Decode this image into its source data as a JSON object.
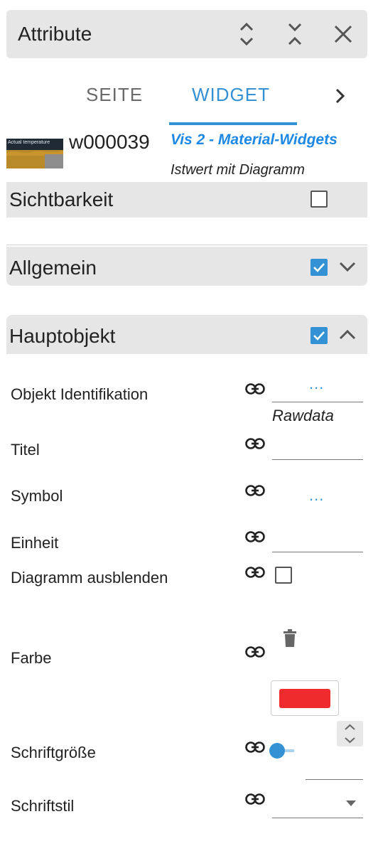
{
  "header": {
    "title": "Attribute"
  },
  "tabs": {
    "seite": "SEITE",
    "widget": "WIDGET"
  },
  "widget": {
    "id": "w000039",
    "set_name": "Vis 2 - Material-Widgets",
    "type_name": "Istwert mit Diagramm",
    "thumbnail_text": "Actual temperature"
  },
  "sections": {
    "sichtbarkeit": {
      "title": "Sichtbarkeit",
      "checked": false
    },
    "allgemein": {
      "title": "Allgemein",
      "checked": true,
      "expanded": false
    },
    "hauptobjekt": {
      "title": "Hauptobjekt",
      "checked": true,
      "expanded": true
    }
  },
  "properties": {
    "objekt_identifikation": {
      "label": "Objekt Identifikation",
      "button": "...",
      "value": "Rawdata"
    },
    "titel": {
      "label": "Titel",
      "value": ""
    },
    "symbol": {
      "label": "Symbol",
      "button": "..."
    },
    "einheit": {
      "label": "Einheit",
      "value": ""
    },
    "diagramm_ausblenden": {
      "label": "Diagramm ausblenden",
      "checked": false
    },
    "farbe": {
      "label": "Farbe",
      "color": "#ef2b2d"
    },
    "schriftgroesse": {
      "label": "Schriftgröße",
      "value": ""
    },
    "schriftstil": {
      "label": "Schriftstil",
      "value": ""
    }
  },
  "colors": {
    "accent": "#3391d4",
    "section_bg": "#e6e6e6",
    "set_name": "#1e88e5"
  }
}
